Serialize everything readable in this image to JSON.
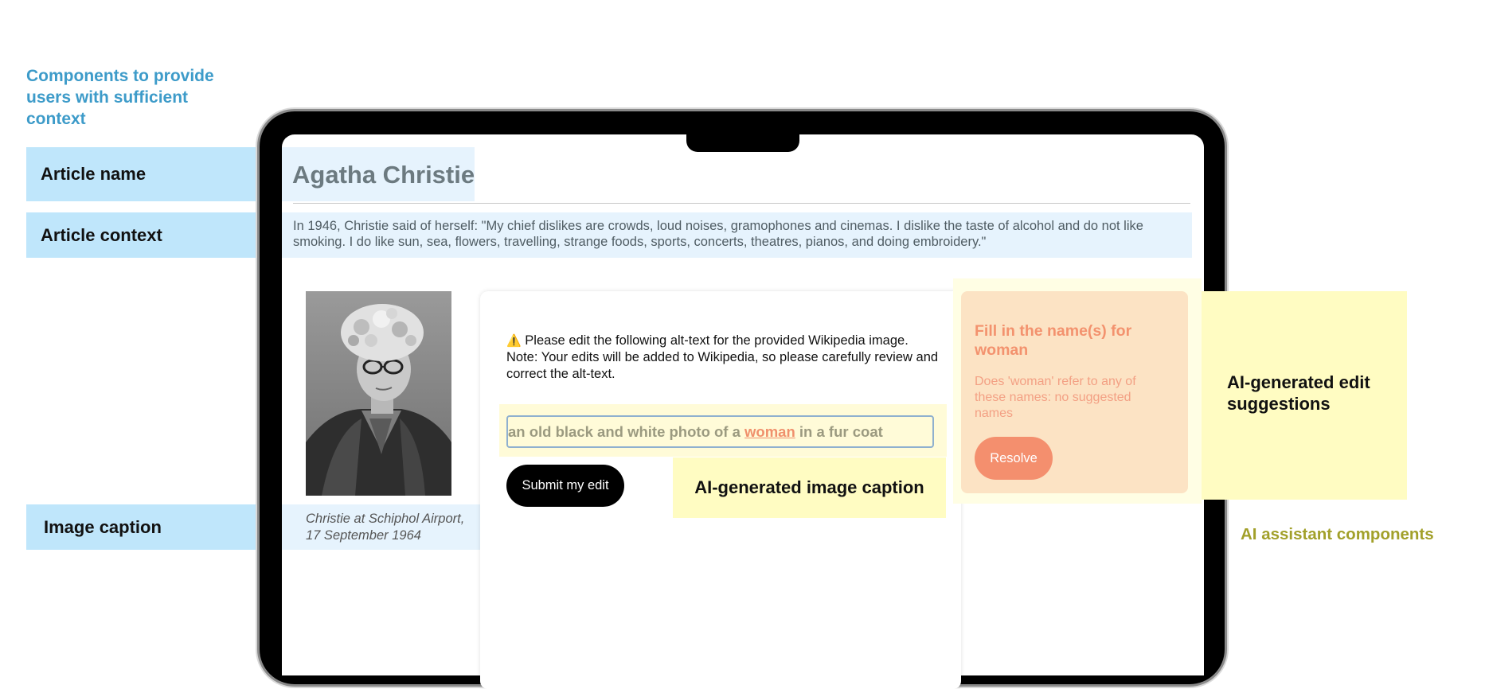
{
  "annotations": {
    "heading": "Components to provide users with sufficient context",
    "article_name": "Article name",
    "article_context": "Article context",
    "image_caption": "Image caption",
    "ai_image_caption": "AI-generated image caption",
    "ai_edit_suggestions": "AI-generated edit suggestions",
    "ai_assistant_components": "AI assistant components"
  },
  "article": {
    "title": "Agatha Christie",
    "context": "In 1946, Christie said of herself: \"My chief dislikes are crowds, loud noises, gramophones and cinemas. I dislike the taste of alcohol and do not like smoking. I do like sun, sea, flowers, travelling, strange foods, sports, concerts, theatres, pianos, and doing embroidery.\"",
    "photo_caption": "Christie at Schiphol Airport, 17 September 1964"
  },
  "editor": {
    "warning_icon": "warning-icon",
    "instructions": "Please edit the following alt-text for the provided Wikipedia image. Note: Your edits will be added to Wikipedia, so please carefully review and correct the alt-text.",
    "caption_before": "an old black and white photo of a ",
    "caption_highlight": "woman",
    "caption_after": " in a fur coat",
    "submit_label": "Submit my edit"
  },
  "suggestion": {
    "title": "Fill in the name(s) for woman",
    "body": "Does 'woman' refer to any of these names: no suggested names",
    "resolve_label": "Resolve"
  },
  "colors": {
    "annotation_blue": "#bfe6fb",
    "annotation_yellow": "#fffcc2",
    "heading_blue": "#3d9bc9",
    "suggestion_card": "#fce3c4",
    "suggestion_accent": "#f48f6e",
    "ai_label_olive": "#a2a02a"
  }
}
